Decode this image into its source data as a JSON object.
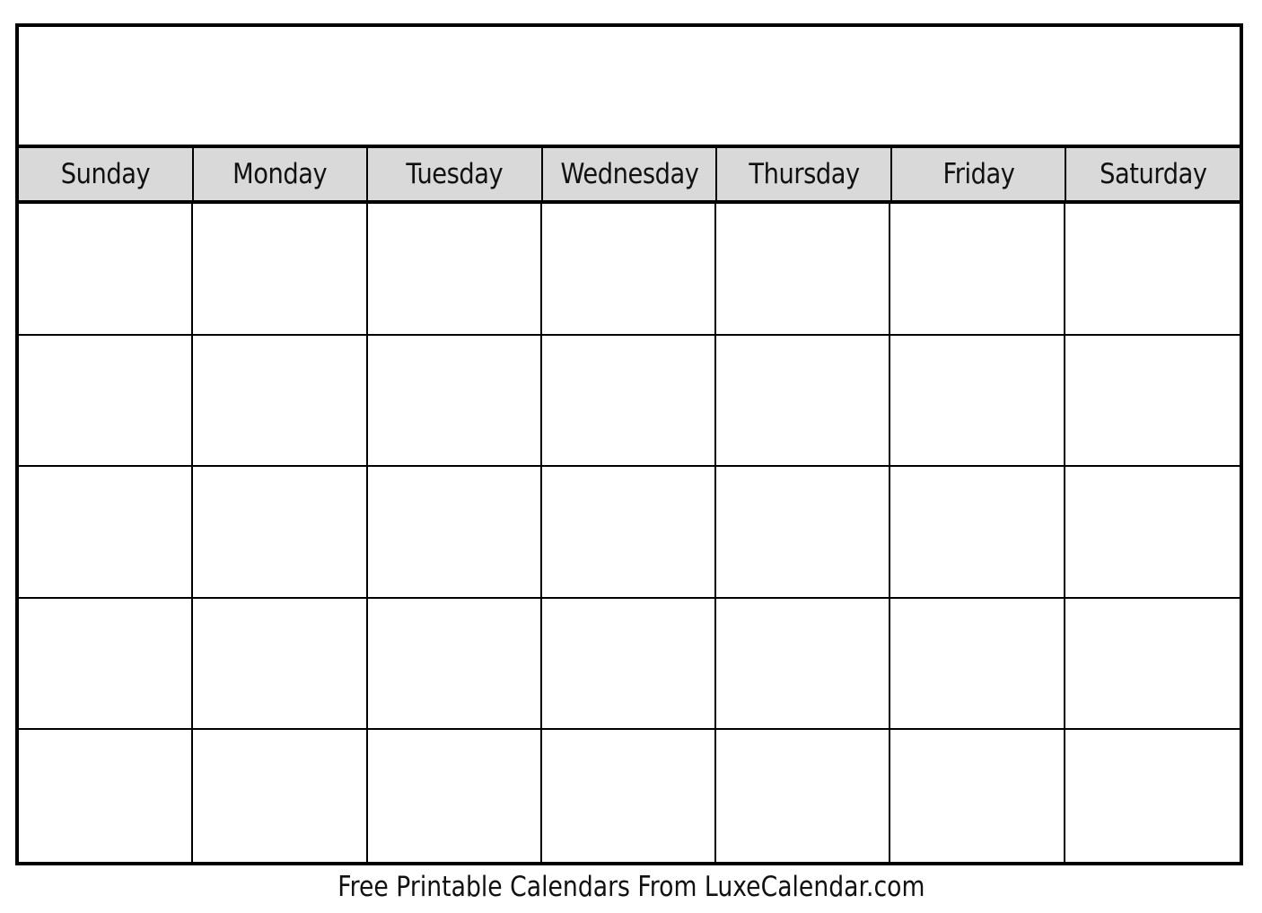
{
  "calendar": {
    "title": "",
    "weekdays": [
      "Sunday",
      "Monday",
      "Tuesday",
      "Wednesday",
      "Thursday",
      "Friday",
      "Saturday"
    ],
    "rows": 5,
    "header_bg_color": "#d9d9d9",
    "border_color": "#000000"
  },
  "footer": {
    "text": "Free Printable Calendars From LuxeCalendar.com"
  }
}
